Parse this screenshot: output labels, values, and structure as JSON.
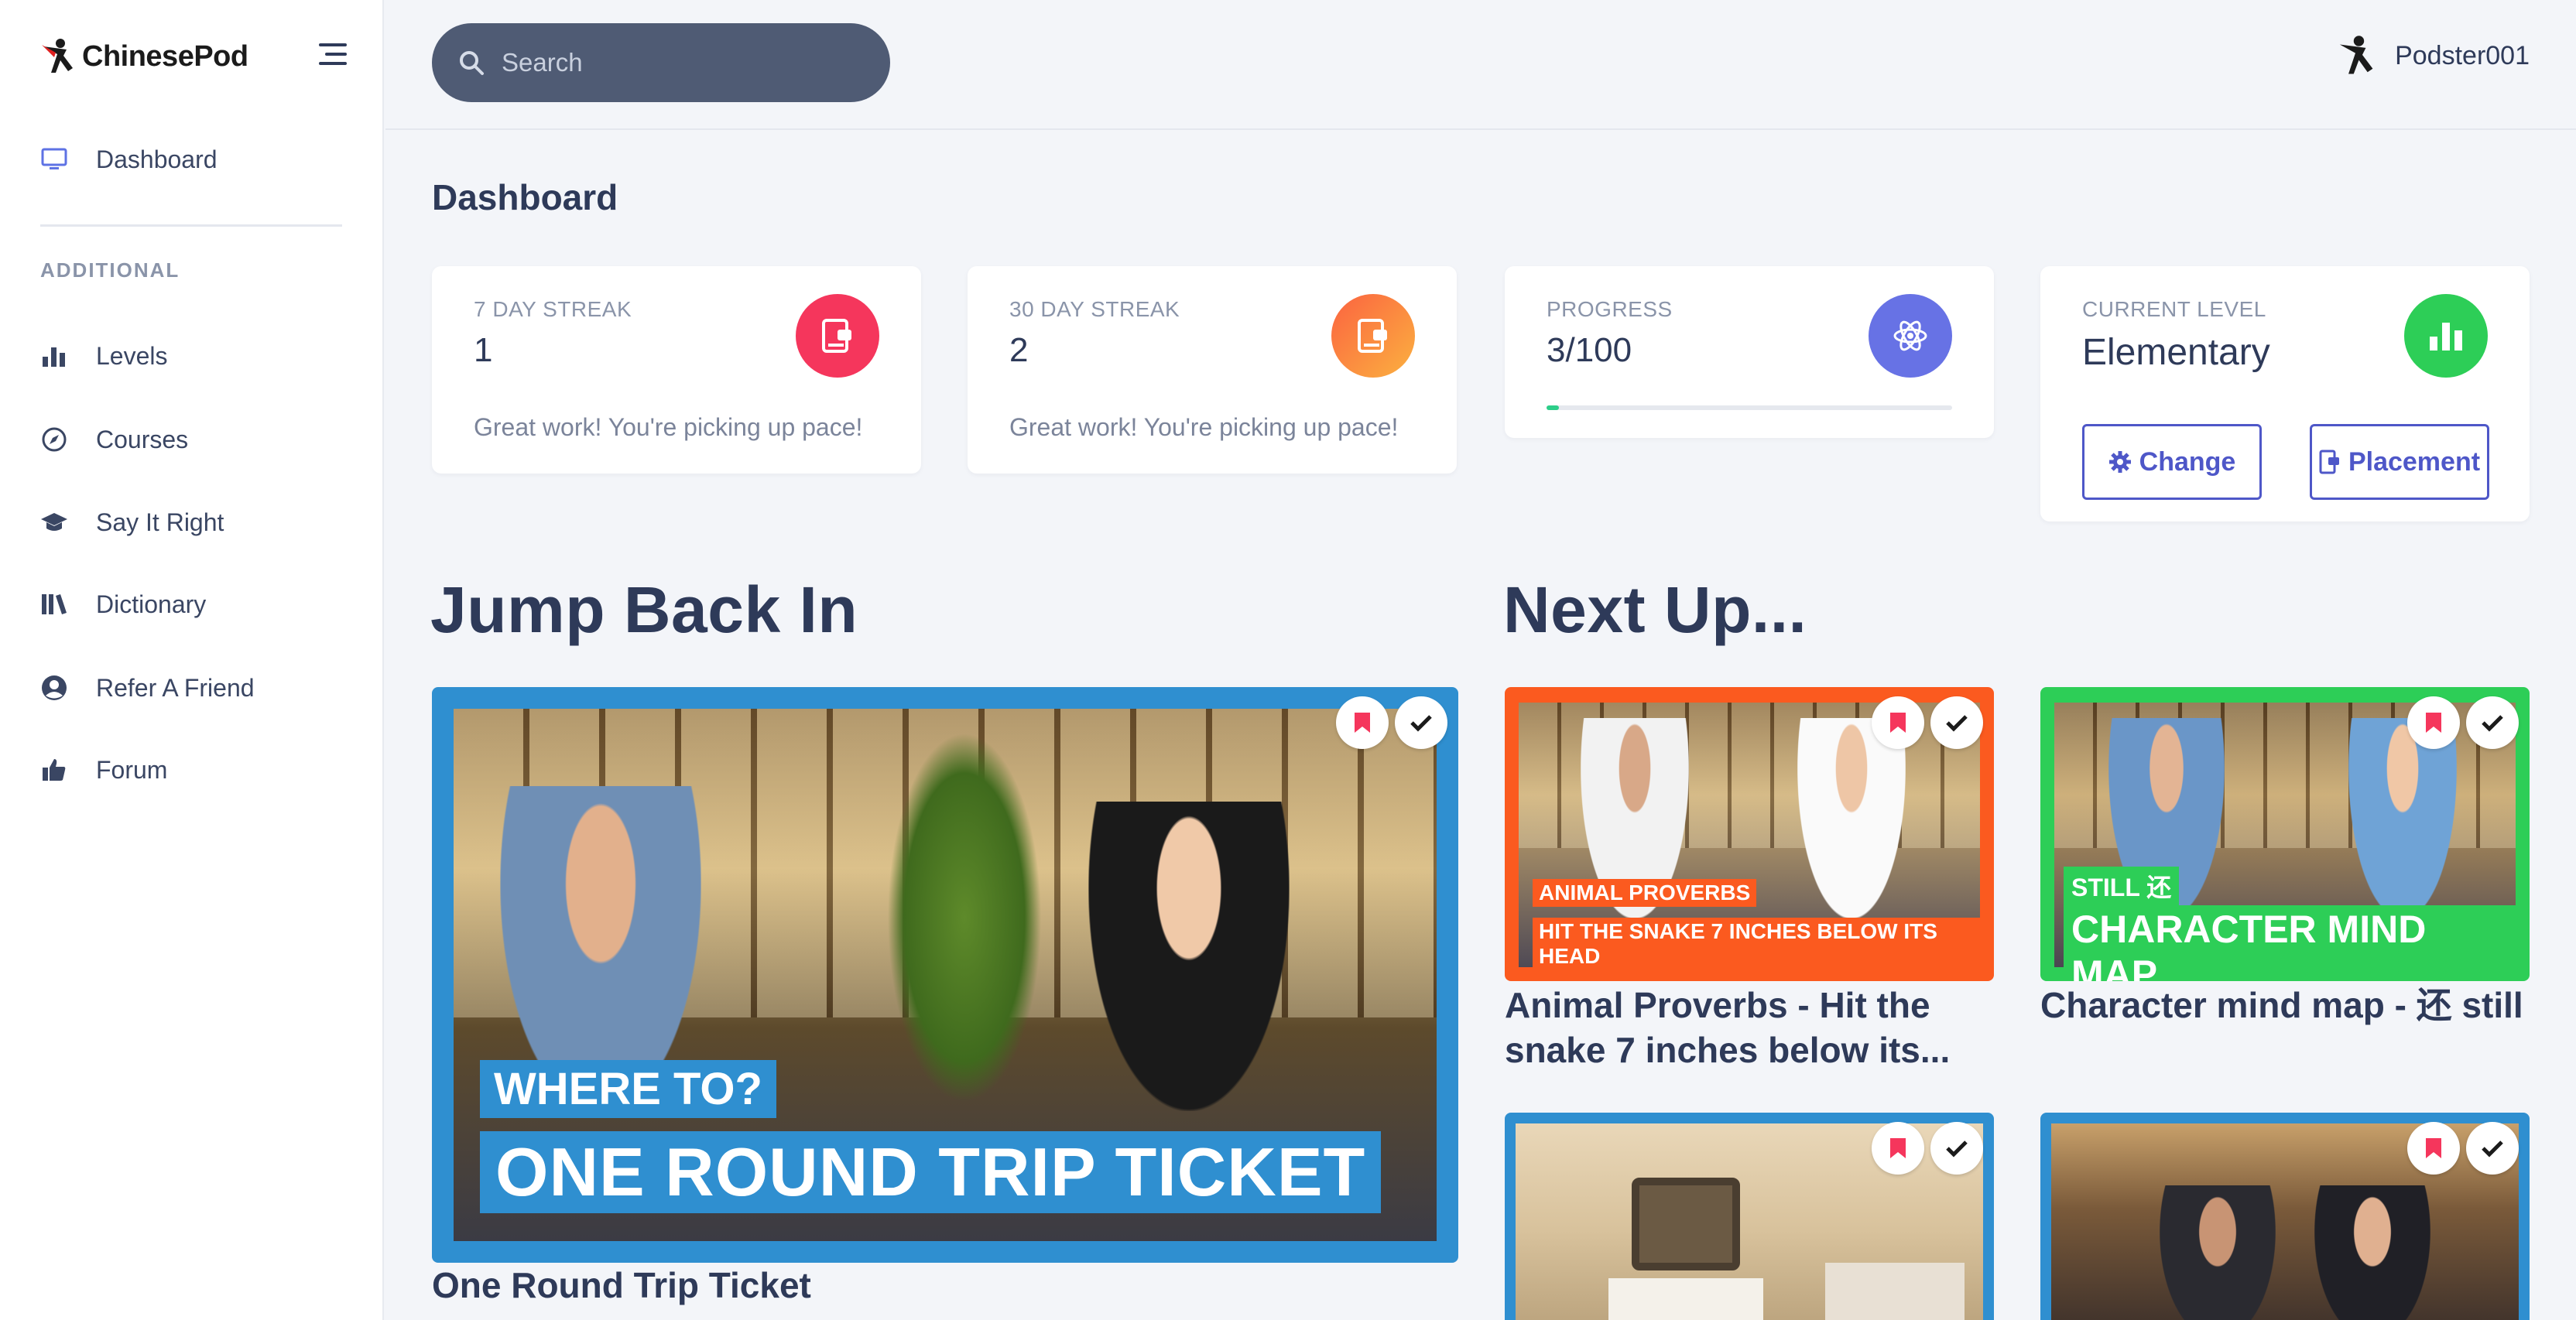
{
  "app": {
    "name": "ChinesePod"
  },
  "sidebar": {
    "primary": [
      {
        "label": "Dashboard",
        "icon": "monitor-icon"
      }
    ],
    "section_label": "ADDITIONAL",
    "items": [
      {
        "label": "Levels",
        "icon": "bar-chart-icon"
      },
      {
        "label": "Courses",
        "icon": "compass-icon"
      },
      {
        "label": "Say It Right",
        "icon": "graduation-cap-icon"
      },
      {
        "label": "Dictionary",
        "icon": "books-icon"
      },
      {
        "label": "Refer A Friend",
        "icon": "user-circle-icon"
      },
      {
        "label": "Forum",
        "icon": "thumbs-up-icon"
      }
    ]
  },
  "topbar": {
    "search_placeholder": "Search",
    "username": "Podster001"
  },
  "page_title": "Dashboard",
  "stats": {
    "streak7": {
      "label": "7 DAY STREAK",
      "value": "1",
      "desc": "Great work! You're picking up pace!",
      "color": "#f5365c"
    },
    "streak30": {
      "label": "30 DAY STREAK",
      "value": "2",
      "desc": "Great work! You're picking up pace!",
      "color": "#fb6340"
    },
    "progress": {
      "label": "PROGRESS",
      "value": "3/100",
      "fraction": 0.03,
      "color": "#6772e5"
    },
    "level": {
      "label": "CURRENT LEVEL",
      "value": "Elementary",
      "color": "#2dce89",
      "change_label": "Change",
      "placement_label": "Placement"
    }
  },
  "jump_back_in": {
    "heading": "Jump Back In",
    "lesson": {
      "title": "One Round Trip Ticket",
      "caption_top": "WHERE TO?",
      "caption_main": "ONE ROUND TRIP TICKET",
      "frame_color": "#2f8fd0"
    }
  },
  "next_up": {
    "heading": "Next Up...",
    "lessons": [
      {
        "title": "Animal Proverbs - Hit the snake 7 inches below its...",
        "caption_top": "ANIMAL PROVERBS",
        "caption_main": "HIT THE SNAKE 7 INCHES BELOW ITS HEAD",
        "frame_color": "#fb5a1f"
      },
      {
        "title": "Character mind map - 还 still",
        "caption_top": "STILL 还",
        "caption_main": "CHARACTER MIND MAP",
        "frame_color": "#2dce57"
      },
      {
        "title": "",
        "frame_color": "#2f8fd0"
      },
      {
        "title": "",
        "frame_color": "#2f8fd0"
      }
    ]
  }
}
